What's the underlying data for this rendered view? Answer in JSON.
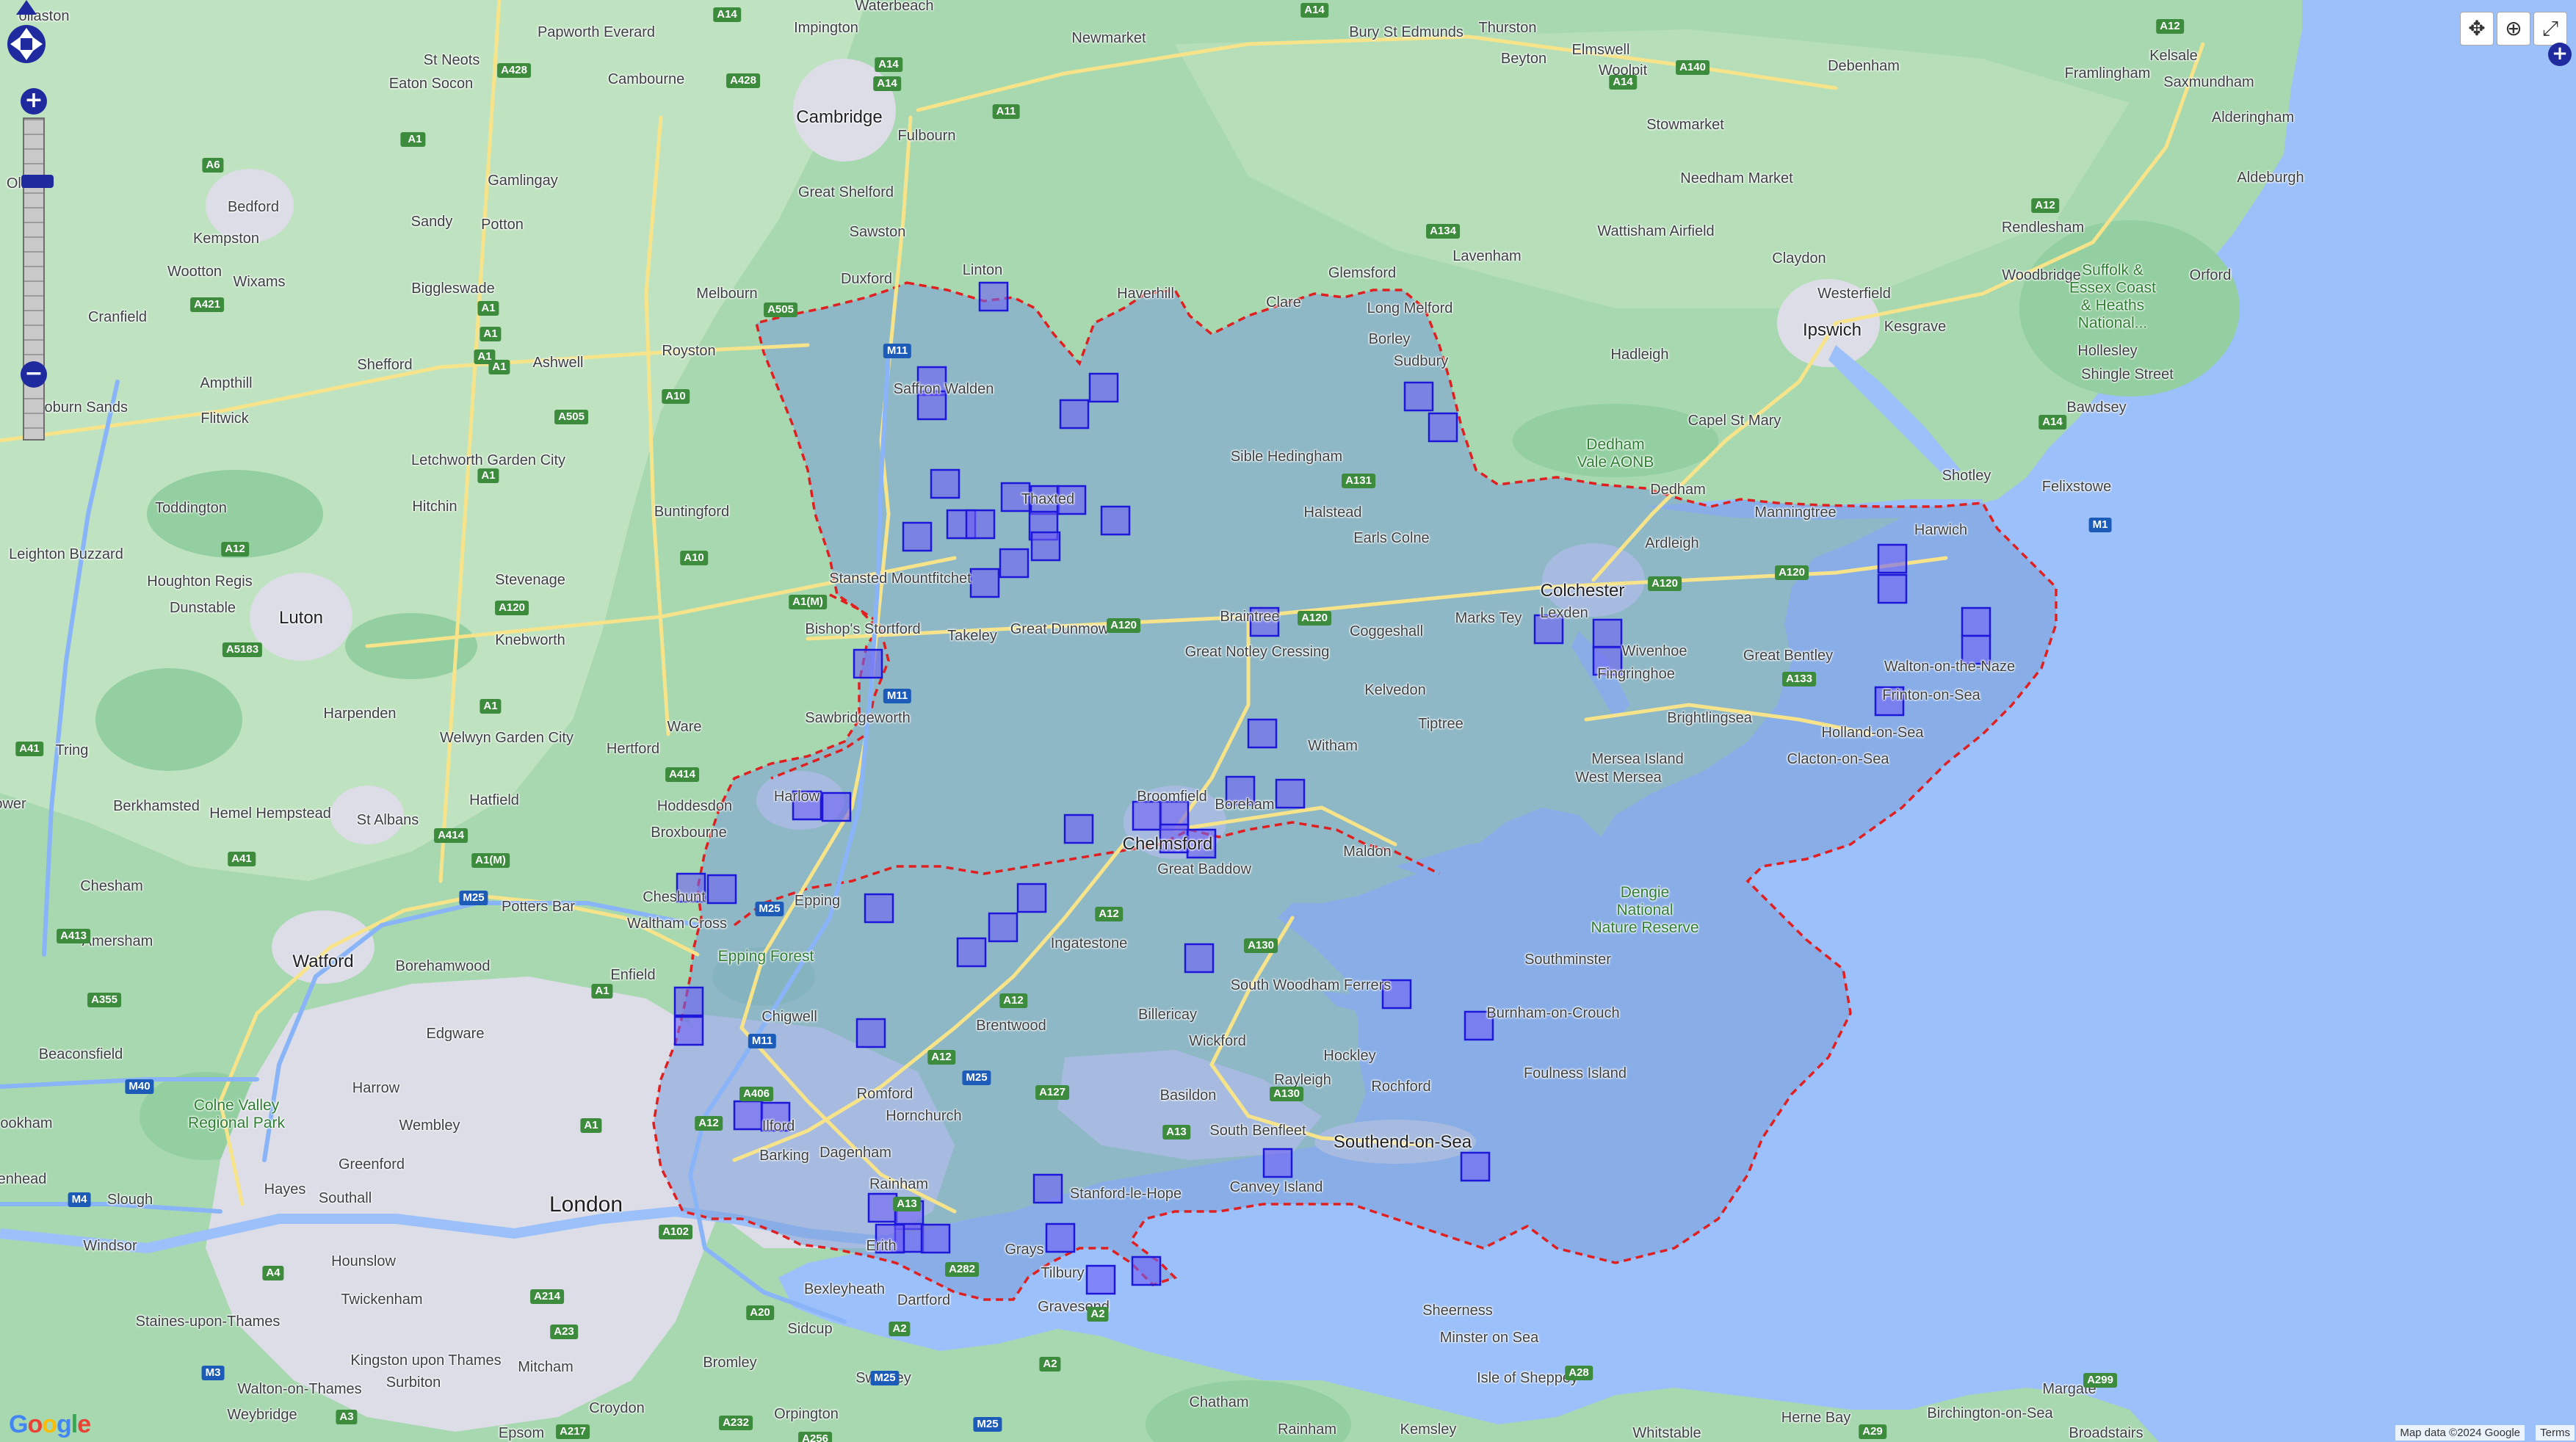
{
  "map": {
    "type": "roadmap",
    "provider": "Google",
    "attribution": "Map data ©2024 Google",
    "terms_label": "Terms",
    "colors": {
      "land": "#a8d8b0",
      "land_light": "#c5e5c5",
      "water": "#9cc0f9",
      "urban": "#dadde6",
      "region_fill": "#7a9fd8",
      "boundary": "#e02020",
      "cell_fill": "#6e5ff5",
      "cell_stroke": "#1c17d9"
    }
  },
  "controls": {
    "zoom_in": "+",
    "zoom_out": "−",
    "zoom_level_fraction": 0.82,
    "tools": [
      "pan-tool-icon",
      "zoom-box-icon",
      "full-extent-icon"
    ],
    "expand_button": "+"
  },
  "places": {
    "Waterbeach": "Waterbeach",
    "Impington": "Impington",
    "Papworth Everard": "Papworth\nEverard",
    "Newmarket": "Newmarket",
    "Bury St Edmunds": "Bury St\nEdmunds",
    "Thurston": "Thurston",
    "Beyton": "Beyton",
    "Elmswell": "Elmswell",
    "Woolpit": "Woolpit",
    "Debenham": "Debenham",
    "Framlingham": "Framlingham",
    "Kelsale": "Kelsale",
    "Saxmundham": "Saxmundham",
    "Alderingham": "Alderingham",
    "Aldeburgh": "Aldeburgh",
    "St Neots": "St Neots",
    "Eaton Socon": "Eaton Socon",
    "Cambourne": "Cambourne",
    "Cambridge": "Cambridge",
    "Fulbourn": "Fulbourn",
    "Stowmarket": "Stowmarket",
    "Needham Market": "Needham\nMarket",
    "Wattisham Airfield": "Wattisham\nAirfield",
    "Claydon": "Claydon",
    "Rendlesham": "Rendlesham",
    "Bedford": "Bedford",
    "Gamlingay": "Gamlingay",
    "Great Shelford": "Great Shelford",
    "Kempston": "Kempston",
    "Sandy": "Sandy",
    "Potton": "Potton",
    "Sawston": "Sawston",
    "Glemsford": "Glemsford",
    "Lavenham": "Lavenham",
    "Woodbridge": "Woodbridge",
    "Orford": "Orford",
    "Wootton": "Wootton",
    "Wixams": "Wixams",
    "Biggleswade": "Biggleswade",
    "Linton": "Linton",
    "Haverhill": "Haverhill",
    "Duxford": "Duxford",
    "Melbourn": "Melbourn",
    "Clare": "Clare",
    "Long Melford": "Long Melford",
    "Westerfield": "Westerfield",
    "Suffolk & Essex Coast & Heaths National...": "Suffolk &\nEssex Coast\n& Heaths\nNational...",
    "Cranfield": "Cranfield",
    "Borley": "Borley",
    "Ipswich": "Ipswich",
    "Kesgrave": "Kesgrave",
    "Hollesley": "Hollesley",
    "Royston": "Royston",
    "Sudbury": "Sudbury",
    "Hadleigh": "Hadleigh",
    "Shingle Street": "Shingle Street",
    "Ampthill": "Ampthill",
    "Shefford": "Shefford",
    "Ashwell": "Ashwell",
    "Saffron Walden": "Saffron\nWalden",
    "Woburn Sands": "Woburn Sands",
    "Flitwick": "Flitwick",
    "Bawdsey": "Bawdsey",
    "Capel St Mary": "Capel St Mary",
    "Dedham Vale AONB": "Dedham\nVale AONB",
    "Sible Hedingham": "Sible\nHedingham",
    "Letchworth Garden City": "Letchworth\nGarden City",
    "Shotley": "Shotley",
    "Felixstowe": "Felixstowe",
    "Dedham": "Dedham",
    "Thaxted": "Thaxted",
    "Manningtree": "Manningtree",
    "Toddington": "Toddington",
    "Hitchin": "Hitchin",
    "Buntingford": "Buntingford",
    "Harwich": "Harwich",
    "Halstead": "Halstead",
    "Earls Colne": "Earls Colne",
    "Ardleigh": "Ardleigh",
    "Leighton Buzzard": "Leighton\nBuzzard",
    "Houghton Regis": "Houghton\nRegis",
    "Stevenage": "Stevenage",
    "Stansted Mountfitchet": "Stansted\nMountfitchet",
    "Colchester": "Colchester",
    "Dunstable": "Dunstable",
    "Luton": "Luton",
    "Knebworth": "Knebworth",
    "Bishop's Stortford": "Bishop's\nStortford",
    "Takeley": "Takeley",
    "Great Dunmow": "Great\nDunmow",
    "Braintree": "Braintree",
    "Coggeshall": "Coggeshall",
    "Marks Tey": "Marks Tey",
    "Lexden": "Lexden",
    "Wivenhoe": "Wivenhoe",
    "Great Notley Cressing": "Great Notley Cressing",
    "Great Bentley": "Great Bentley",
    "Walton-on-the-Naze": "Walton-on-the-Naze",
    "Fingringhoe": "Fingringhoe",
    "Kelvedon": "Kelvedon",
    "Harpenden": "Harpenden",
    "Welwyn Garden City": "Welwyn\nGarden City",
    "Ware": "Ware",
    "Sawbridgeworth": "Sawbridgeworth",
    "Tiptree": "Tiptree",
    "Brightlingsea": "Brightlingsea",
    "Frinton-on-Sea": "Frinton-on-Sea",
    "Holland-on-Sea": "Holland-on-Sea",
    "Tring": "Tring",
    "Hertford": "Hertford",
    "Witham": "Witham",
    "Mersea Island": "Mersea Island",
    "Clacton-on-Sea": "Clacton-on-Sea",
    "West Mersea": "West Mersea",
    "Hemel Hempstead": "Hemel\nHempstead",
    "Berkhamsted": "Berkhamsted",
    "Hatfield": "Hatfield",
    "Hoddesdon": "Hoddesdon",
    "Harlow": "Harlow",
    "Broomfield": "Broomfield",
    "Boreham": "Boreham",
    "St Albans": "St Albans",
    "Broxbourne": "Broxbourne",
    "Chelmsford": "Chelmsford",
    "Maldon": "Maldon",
    "Great Baddow": "Great Baddow",
    "Chesham": "Chesham",
    "Epping": "Epping",
    "Cheshunt": "Cheshunt",
    "Dengie National Nature Reserve": "Dengie\nNational\nNature Reserve",
    "Amersham": "Amersham",
    "Potters Bar": "Potters Bar",
    "Waltham Cross": "Waltham Cross",
    "Ingatestone": "Ingatestone",
    "Watford": "Watford",
    "Borehamwood": "Borehamwood",
    "Epping Forest": "Epping Forest",
    "Southminster": "Southminster",
    "South Woodham Ferrers": "South\nWoodham\nFerrers",
    "Enfield": "Enfield",
    "Chigwell": "Chigwell",
    "Brentwood": "Brentwood",
    "Billericay": "Billericay",
    "Burnham-on-Crouch": "Burnham-on-Crouch",
    "Beaconsfield": "Beaconsfield",
    "Edgware": "Edgware",
    "Wickford": "Wickford",
    "Hockley": "Hockley",
    "Foulness Island": "Foulness\nIsland",
    "Rayleigh": "Rayleigh",
    "Harrow": "Harrow",
    "Romford": "Romford",
    "Basildon": "Basildon",
    "Rochford": "Rochford",
    "Colne Valley Regional Park": "Colne Valley\nRegional Park",
    "Ilford": "Ilford",
    "Hornchurch": "Hornchurch",
    "Wembley": "Wembley",
    "South Benfleet": "South Benfleet",
    "Southend-on-Sea": "Southend-on-Sea",
    "Barking": "Barking",
    "Dagenham": "Dagenham",
    "Greenford": "Greenford",
    "Canvey Island": "Canvey Island",
    "Hayes": "Hayes",
    "Southall": "Southall",
    "Slough": "Slough",
    "London": "London",
    "Stanford-le-Hope": "Stanford-le-Hope",
    "Rainham": "Rainham",
    "Windsor": "Windsor",
    "Hounslow": "Hounslow",
    "Erith": "Erith",
    "Grays": "Grays",
    "Tilbury": "Tilbury",
    "Bexleyheath": "Bexleyheath",
    "Dartford": "Dartford",
    "Gravesend": "Gravesend",
    "Twickenham": "Twickenham",
    "Sheerness": "Sheerness",
    "Staines-upon-Thames": "Staines-upon-Thames",
    "Kingston upon Thames": "Kingston\nupon Thames",
    "Sidcup": "Sidcup",
    "Minster on Sea": "Minster on Sea",
    "Bromley": "Bromley",
    "Mitcham": "Mitcham",
    "Isle of Sheppey": "Isle of\nSheppey",
    "Surbiton": "Surbiton",
    "Swanley": "Swanley",
    "Walton-on-Thames": "Walton-on-Thames",
    "Margate": "Margate",
    "Weybridge": "Weybridge",
    "Croydon": "Croydon",
    "Orpington": "Orpington",
    "Chatham": "Chatham",
    "Herne Bay": "Herne Bay",
    "Birchington-on-Sea": "Birchington-on-Sea",
    "Epsom": "Epsom",
    "Rainham Kent": "Rainham",
    "Kemsley": "Kemsley",
    "Whitstable": "Whitstable",
    "Broadstairs": "Broadstairs",
    "Olney": "Olney",
    "Ollaston": "ollaston",
    "Slough2": "Slough",
    "Enhead": "enhead",
    "Ookham": "ookham",
    "Ower": "ower"
  },
  "roads": [
    "A14",
    "A14",
    "A14",
    "A12",
    "A428",
    "A428",
    "A14",
    "A1",
    "A11",
    "A6",
    "A1",
    "A140",
    "A14",
    "A1",
    "A134",
    "A421",
    "A12",
    "A1",
    "A1",
    "A1",
    "A505",
    "M11",
    "A10",
    "A505",
    "A14",
    "A1",
    "A10",
    "A12",
    "M1",
    "A131",
    "A120",
    "A1(M)",
    "A120",
    "A120",
    "A120",
    "A5183",
    "A133",
    "A120",
    "A1",
    "M11",
    "A41",
    "A1(M)",
    "A414",
    "A414",
    "A12",
    "M25",
    "M25",
    "A413",
    "A130",
    "A41",
    "A12",
    "A1",
    "A12",
    "M11",
    "A355",
    "A406",
    "A1",
    "M25",
    "A127",
    "M40",
    "A12",
    "A130",
    "A13",
    "A13",
    "A102",
    "A4",
    "A282",
    "M4",
    "A2",
    "A20",
    "A214",
    "A23",
    "M3",
    "A2",
    "M25",
    "A232",
    "M25",
    "A2",
    "A28",
    "A29",
    "A299",
    "A256",
    "A217",
    "A3"
  ],
  "coverage_cells": [
    "grid-cell-1",
    "grid-cell-2",
    "grid-cell-3",
    "grid-cell-4",
    "grid-cell-5",
    "grid-cell-6",
    "grid-cell-7",
    "grid-cell-8",
    "grid-cell-9",
    "grid-cell-10",
    "grid-cell-11",
    "grid-cell-12",
    "grid-cell-13",
    "grid-cell-14",
    "grid-cell-15",
    "grid-cell-16",
    "grid-cell-17",
    "grid-cell-18",
    "grid-cell-19",
    "grid-cell-20",
    "grid-cell-21",
    "grid-cell-22",
    "grid-cell-23",
    "grid-cell-24",
    "grid-cell-25",
    "grid-cell-26",
    "grid-cell-27",
    "grid-cell-28",
    "grid-cell-29",
    "grid-cell-30",
    "grid-cell-31",
    "grid-cell-32",
    "grid-cell-33",
    "grid-cell-34",
    "grid-cell-35",
    "grid-cell-36",
    "grid-cell-37",
    "grid-cell-38",
    "grid-cell-39",
    "grid-cell-40",
    "grid-cell-41",
    "grid-cell-42",
    "grid-cell-43",
    "grid-cell-44",
    "grid-cell-45",
    "grid-cell-46",
    "grid-cell-47",
    "grid-cell-48",
    "grid-cell-49",
    "grid-cell-50",
    "grid-cell-51",
    "grid-cell-52",
    "grid-cell-53",
    "grid-cell-54",
    "grid-cell-55",
    "grid-cell-56",
    "grid-cell-57",
    "grid-cell-58",
    "grid-cell-59",
    "grid-cell-60",
    "grid-cell-61",
    "grid-cell-62",
    "grid-cell-63",
    "grid-cell-64"
  ]
}
